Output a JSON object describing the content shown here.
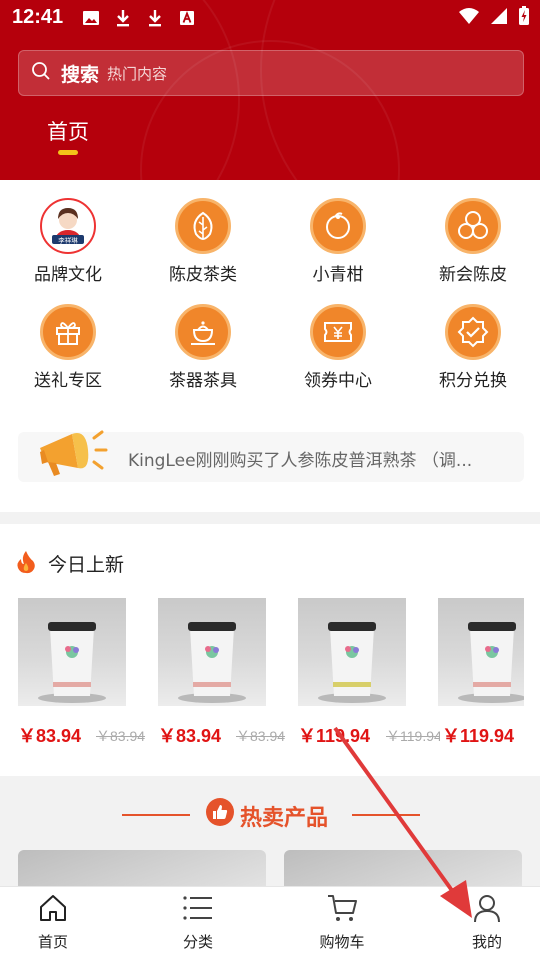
{
  "status_bar": {
    "time": "12:41",
    "left_icons": [
      "image-icon",
      "download-icon",
      "download-icon",
      "text-a-icon"
    ],
    "right_icons": [
      "wifi-icon",
      "signal-icon",
      "battery-charging-icon"
    ]
  },
  "search": {
    "icon": "search-icon",
    "label": "搜索",
    "hint": "热门内容"
  },
  "top_tabs": [
    {
      "label": "首页",
      "active": true
    }
  ],
  "categories": [
    {
      "label": "品牌文化",
      "icon": "brand-logo-icon"
    },
    {
      "label": "陈皮茶类",
      "icon": "leaf-icon"
    },
    {
      "label": "小青柑",
      "icon": "citrus-icon"
    },
    {
      "label": "新会陈皮",
      "icon": "peel-icon"
    },
    {
      "label": "送礼专区",
      "icon": "gift-icon"
    },
    {
      "label": "茶器茶具",
      "icon": "teapot-icon"
    },
    {
      "label": "领券中心",
      "icon": "coupon-icon"
    },
    {
      "label": "积分兑换",
      "icon": "points-badge-icon"
    }
  ],
  "brand_logo_text": "李祥琳",
  "notice": {
    "icon": "megaphone-icon",
    "text": "KingLee刚刚购买了人参陈皮普洱熟茶 （调..."
  },
  "new_today": {
    "title": "今日上新",
    "icon": "fire-icon",
    "products": [
      {
        "price": "￥83.94",
        "old_price": "￥83.94"
      },
      {
        "price": "￥83.94",
        "old_price": "￥83.94"
      },
      {
        "price": "￥119.94",
        "old_price": "￥119.94"
      },
      {
        "price": "￥119.94",
        "old_price": ""
      }
    ]
  },
  "hot": {
    "title": "热卖产品",
    "icon": "thumbs-up-icon"
  },
  "bottom_nav": [
    {
      "label": "首页",
      "icon": "home-icon"
    },
    {
      "label": "分类",
      "icon": "list-icon"
    },
    {
      "label": "购物车",
      "icon": "cart-icon"
    },
    {
      "label": "我的",
      "icon": "user-icon"
    }
  ],
  "colors": {
    "header_red": "#b5000c",
    "accent_orange": "#f0862a",
    "price_red": "#e01414",
    "hot_orange": "#e5532b",
    "tab_underline": "#f3c21a",
    "annotation_arrow": "#e03a3a"
  }
}
